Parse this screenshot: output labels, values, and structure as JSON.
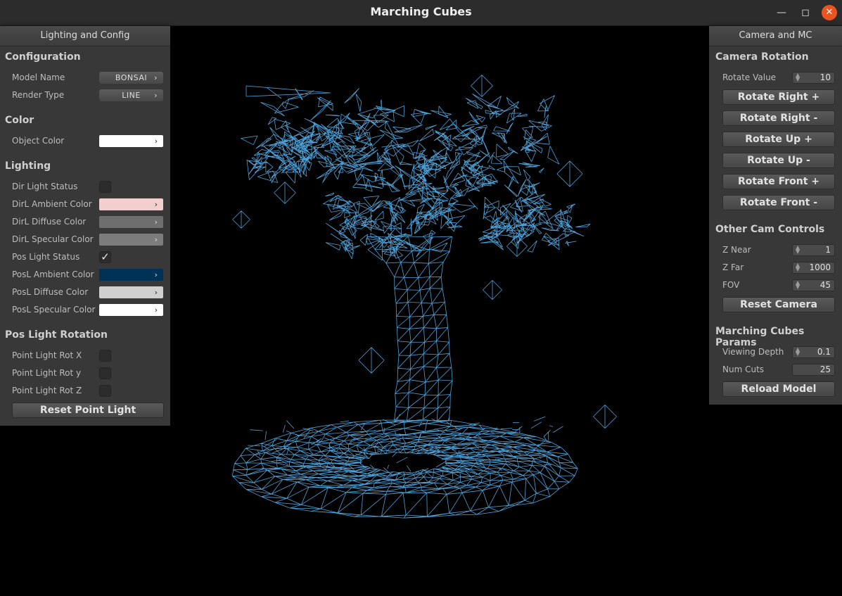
{
  "window": {
    "title": "Marching Cubes"
  },
  "left_panel": {
    "title": "Lighting and Config",
    "configuration": {
      "heading": "Configuration",
      "model_name_label": "Model Name",
      "model_name_value": "BONSAI",
      "render_type_label": "Render Type",
      "render_type_value": "LINE"
    },
    "color": {
      "heading": "Color",
      "object_color_label": "Object Color",
      "object_color": "#ffffff"
    },
    "lighting": {
      "heading": "Lighting",
      "dir_light_status_label": "Dir Light Status",
      "dir_light_status": false,
      "dirl_ambient_label": "DirL Ambient Color",
      "dirl_ambient": "#f2cfcf",
      "dirl_diffuse_label": "DirL Diffuse Color",
      "dirl_diffuse": "#6e6e6e",
      "dirl_specular_label": "DirL Specular Color",
      "dirl_specular": "#7c7c7c",
      "pos_light_status_label": "Pos Light Status",
      "pos_light_status": true,
      "posl_ambient_label": "PosL Ambient Color",
      "posl_ambient": "#003258",
      "posl_diffuse_label": "PosL Diffuse Color",
      "posl_diffuse": "#d0d0d0",
      "posl_specular_label": "PosL Specular Color",
      "posl_specular": "#ffffff"
    },
    "pos_light_rotation": {
      "heading": "Pos Light Rotation",
      "rot_x_label": "Point Light Rot X",
      "rot_y_label": "Point Light Rot y",
      "rot_z_label": "Point Light Rot Z",
      "reset_label": "Reset Point Light"
    }
  },
  "right_panel": {
    "title": "Camera and MC",
    "camera_rotation": {
      "heading": "Camera Rotation",
      "rotate_value_label": "Rotate Value",
      "rotate_value": "10",
      "rotate_right_plus": "Rotate Right +",
      "rotate_right_minus": "Rotate Right -",
      "rotate_up_plus": "Rotate Up +",
      "rotate_up_minus": "Rotate Up -",
      "rotate_front_plus": "Rotate Front +",
      "rotate_front_minus": "Rotate Front -"
    },
    "other_cam": {
      "heading": "Other Cam Controls",
      "z_near_label": "Z Near",
      "z_near": "1",
      "z_far_label": "Z Far",
      "z_far": "1000",
      "fov_label": "FOV",
      "fov": "45",
      "reset_camera": "Reset Camera"
    },
    "mc_params": {
      "heading": "Marching Cubes Params",
      "viewing_depth_label": "Viewing Depth",
      "viewing_depth": "0.1",
      "num_cuts_label": "Num Cuts",
      "num_cuts": "25",
      "reload_model": "Reload Model"
    }
  },
  "colors": {
    "wireframe": "#58b4f0",
    "close_button": "#e95420"
  }
}
